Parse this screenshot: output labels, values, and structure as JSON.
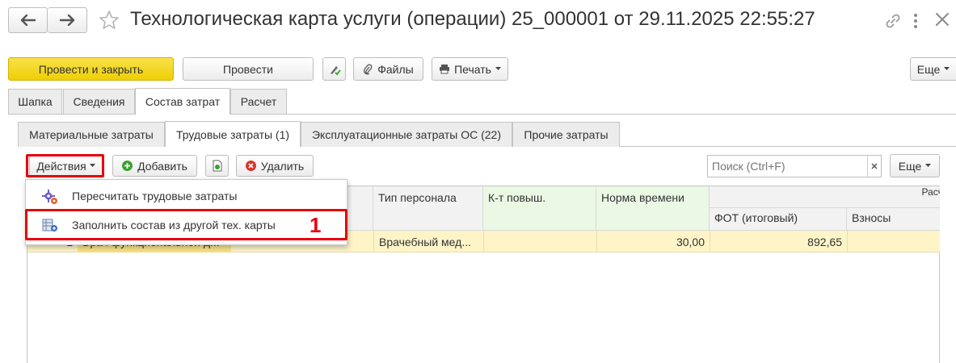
{
  "window": {
    "title": "Технологическая карта услуги (операции) 25_000001 от 29.11.2025 22:55:27"
  },
  "toolbar": {
    "post_close": "Провести и закрыть",
    "post": "Провести",
    "files": "Файлы",
    "print": "Печать",
    "more": "Еще"
  },
  "tabs": [
    "Шапка",
    "Сведения",
    "Состав затрат",
    "Расчет"
  ],
  "subtabs": [
    "Материальные затраты",
    "Трудовые затраты (1)",
    "Эксплуатационные затраты ОС (22)",
    "Прочие затраты"
  ],
  "table_toolbar": {
    "actions": "Действия",
    "add": "Добавить",
    "delete": "Удалить",
    "search_placeholder": "Поиск (Ctrl+F)",
    "more": "Еще"
  },
  "dropdown": {
    "items": [
      "Пересчитать трудовые затраты",
      "Заполнить состав из другой тех. карты"
    ]
  },
  "annotation": {
    "label": "1"
  },
  "columns": {
    "staff_type": "Тип персонала",
    "coef": "К-т повыш.",
    "time_norm": "Норма времени",
    "calc_group": "Расчет затрат",
    "fot": "ФОТ (итоговый)",
    "contrib": "Взносы"
  },
  "row": {
    "index": "1",
    "name": "Врач функциональной д...",
    "staff_type": "Врачебный мед...",
    "coef": "",
    "time_norm": "30,00",
    "fot": "892,65",
    "contrib": ""
  },
  "colors": {
    "primary_button": "#f5d81d",
    "highlight_box": "#e8000b",
    "selected_row": "#fdf4c8"
  }
}
